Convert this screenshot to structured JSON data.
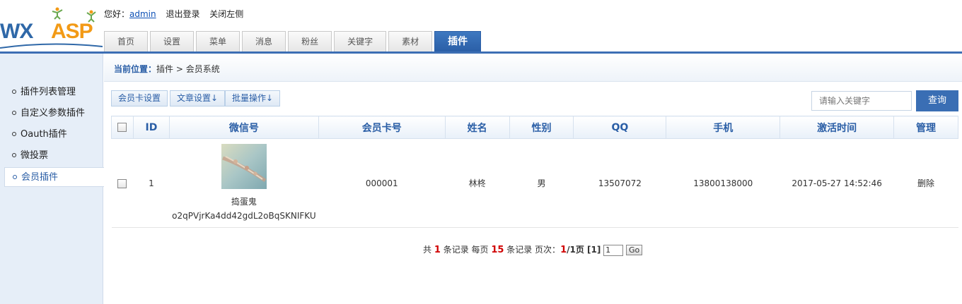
{
  "logo": {
    "part1": "WX",
    "part2": "ASP"
  },
  "topbar": {
    "greeting": "您好：",
    "username": "admin",
    "logout": "退出登录",
    "close_left": "关闭左侧"
  },
  "nav": [
    "首页",
    "设置",
    "菜单",
    "消息",
    "粉丝",
    "关键字",
    "素材",
    "插件"
  ],
  "nav_active": "插件",
  "sidebar": [
    "插件列表管理",
    "自定义参数插件",
    "Oauth插件",
    "微投票",
    "会员插件"
  ],
  "breadcrumb": {
    "label": "当前位置：",
    "path": "插件 > 会员系统"
  },
  "toolbar": [
    "会员卡设置",
    "文章设置↓",
    "批量操作↓"
  ],
  "search": {
    "placeholder": "请输入关键字",
    "button": "查询"
  },
  "table": {
    "headers": [
      "ID",
      "微信号",
      "会员卡号",
      "姓名",
      "性别",
      "QQ",
      "手机",
      "激活时间",
      "管理"
    ],
    "rows": [
      {
        "id": "1",
        "nickname": "捣蛋鬼",
        "openid": "o2qPVjrKa4dd42gdL2oBqSKNIFKU",
        "card": "000001",
        "name": "林柊",
        "gender": "男",
        "qq": "13507072",
        "phone": "13800138000",
        "time": "2017-05-27 14:52:46",
        "action": "删除"
      }
    ]
  },
  "pager": {
    "t1": "共 ",
    "total": "1",
    "t2": " 条记录 每页 ",
    "per": "15",
    "t3": " 条记录 页次：",
    "cur": "1",
    "t4": "/1页 [1]",
    "page_input": "1",
    "go": "Go"
  },
  "colors": {
    "accent": "#3c6eb4",
    "red": "#d00000"
  }
}
